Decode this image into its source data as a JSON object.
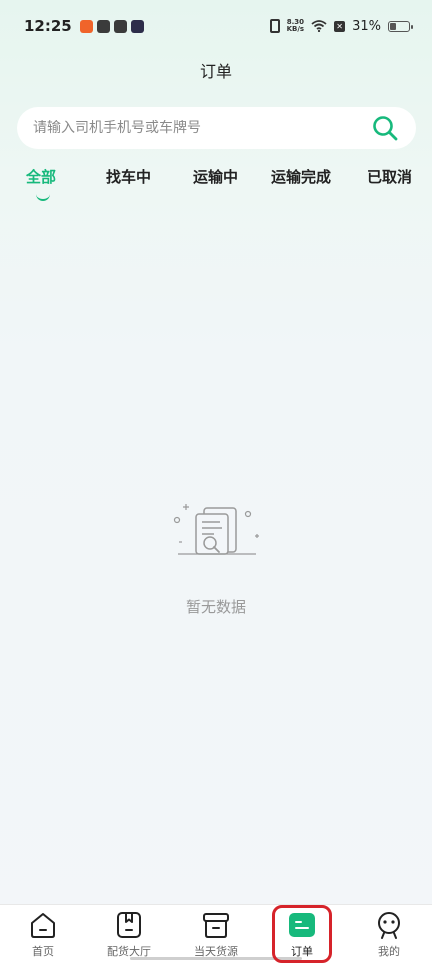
{
  "status_bar": {
    "time": "12:25",
    "net_speed_top": "8.30",
    "net_speed_bottom": "KB/s",
    "battery": "31%",
    "battery_level": 0.31,
    "x_badge": "✕"
  },
  "header": {
    "title": "订单"
  },
  "search": {
    "placeholder": "请输入司机手机号或车牌号",
    "value": ""
  },
  "tabs": [
    {
      "label": "全部",
      "active": true
    },
    {
      "label": "找车中",
      "active": false
    },
    {
      "label": "运输中",
      "active": false
    },
    {
      "label": "运输完成",
      "active": false
    },
    {
      "label": "已取消",
      "active": false
    }
  ],
  "empty_state": {
    "text": "暂无数据"
  },
  "bottom_nav": [
    {
      "label": "首页",
      "icon": "home-icon",
      "active": false
    },
    {
      "label": "配货大厅",
      "icon": "bookmark-book-icon",
      "active": false
    },
    {
      "label": "当天货源",
      "icon": "archive-box-icon",
      "active": false
    },
    {
      "label": "订单",
      "icon": "order-list-icon",
      "active": true
    },
    {
      "label": "我的",
      "icon": "profile-face-icon",
      "active": false
    }
  ],
  "colors": {
    "accent": "#17b97c",
    "highlight": "#d6232a"
  }
}
